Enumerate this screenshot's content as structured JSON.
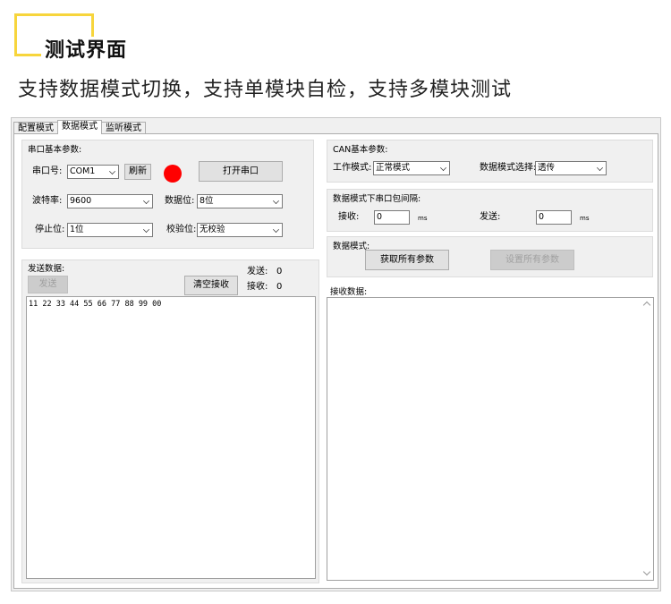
{
  "header": {
    "title": "测试界面",
    "subtitle": "支持数据模式切换，支持单模块自检，支持多模块测试",
    "accent_color": "#f7d53c"
  },
  "tabs": [
    {
      "label": "配置模式"
    },
    {
      "label": "数据模式"
    },
    {
      "label": "监听模式"
    }
  ],
  "active_tab": "数据模式",
  "serial": {
    "group_label": "串口基本参数:",
    "port_label": "串口号:",
    "port_value": "COM1",
    "refresh_label": "刷新",
    "status_color": "#ff0000",
    "open_label": "打开串口",
    "baud_label": "波特率:",
    "baud_value": "9600",
    "databits_label": "数据位:",
    "databits_value": "8位",
    "stopbits_label": "停止位:",
    "stopbits_value": "1位",
    "parity_label": "校验位:",
    "parity_value": "无校验"
  },
  "send": {
    "group_label": "发送数据:",
    "send_label": "发送",
    "clear_label": "清空接收",
    "sent_label": "发送:",
    "sent_count": "0",
    "recv_label": "接收:",
    "recv_count": "0",
    "content": "11 22 33 44 55 66 77 88 99 00"
  },
  "can": {
    "group_label": "CAN基本参数:",
    "work_mode_label": "工作模式:",
    "work_mode_value": "正常模式",
    "data_mode_label": "数据模式选择:",
    "data_mode_value": "透传"
  },
  "interval": {
    "group_label": "数据模式下串口包间隔:",
    "recv_label": "接收:",
    "recv_value": "0",
    "recv_unit": "ms",
    "send_label": "发送:",
    "send_value": "0",
    "send_unit": "ms"
  },
  "datamode": {
    "group_label": "数据模式:",
    "get_all_label": "获取所有参数",
    "set_all_label": "设置所有参数"
  },
  "receive": {
    "group_label": "接收数据:",
    "content": ""
  }
}
